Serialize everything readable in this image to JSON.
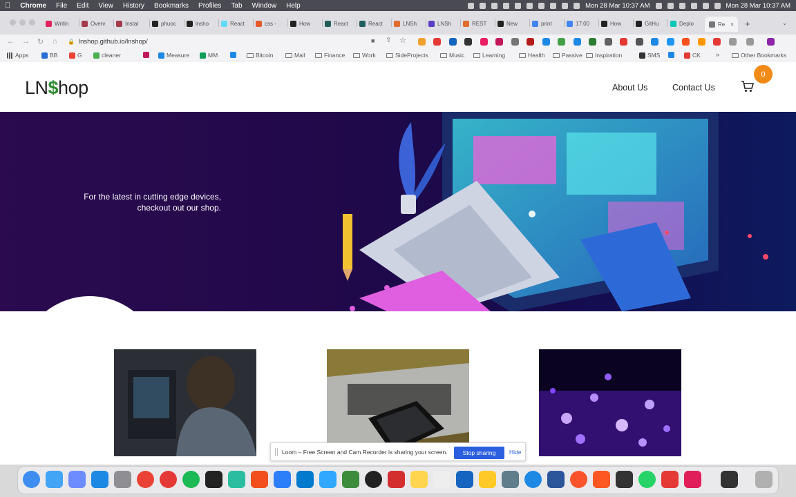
{
  "menubar": {
    "app": "Chrome",
    "items": [
      "File",
      "Edit",
      "View",
      "History",
      "Bookmarks",
      "Profiles",
      "Tab",
      "Window",
      "Help"
    ],
    "datetime": "Mon 28 Mar  10:37 AM"
  },
  "tabs": [
    {
      "label": "Writin",
      "color": "#e0245e"
    },
    {
      "label": "Overv",
      "color": "#a33b4b"
    },
    {
      "label": "Instal",
      "color": "#a33b4b"
    },
    {
      "label": "phuoc",
      "color": "#222222"
    },
    {
      "label": "lnsho",
      "color": "#222222"
    },
    {
      "label": "React",
      "color": "#61dafb"
    },
    {
      "label": "css -",
      "color": "#e55a2b"
    },
    {
      "label": "How",
      "color": "#222222"
    },
    {
      "label": "React",
      "color": "#1f5f5f"
    },
    {
      "label": "React",
      "color": "#1f5f5f"
    },
    {
      "label": "LNSh",
      "color": "#e06c2d"
    },
    {
      "label": "LNSh",
      "color": "#5b3cc4"
    },
    {
      "label": "REST",
      "color": "#e06c2d"
    },
    {
      "label": "New",
      "color": "#222222"
    },
    {
      "label": "print",
      "color": "#4285f4"
    },
    {
      "label": "17:00",
      "color": "#4285f4"
    },
    {
      "label": "How",
      "color": "#222222"
    },
    {
      "label": "GitHu",
      "color": "#222222"
    },
    {
      "label": "Deplo",
      "color": "#00c7b7"
    },
    {
      "label": "Re",
      "color": "#777777",
      "active": true
    }
  ],
  "toolbar": {
    "url": "lnshop.github.io/lnshop/"
  },
  "bookmarks": {
    "items": [
      {
        "label": "Apps",
        "kind": "apps"
      },
      {
        "label": "BB",
        "kind": "icon",
        "color": "#2b6cd4"
      },
      {
        "label": "G",
        "kind": "icon",
        "color": "#ea4335"
      },
      {
        "label": "cleaner",
        "kind": "icon",
        "color": "#4caf50"
      },
      {
        "label": "",
        "kind": "icon",
        "color": "#c2185b"
      },
      {
        "label": "Measure",
        "kind": "icon",
        "color": "#1e88e5"
      },
      {
        "label": "MM",
        "kind": "icon",
        "color": "#0f9d58"
      },
      {
        "label": "",
        "kind": "icon",
        "color": "#1e88e5"
      },
      {
        "label": "Bitcoin",
        "kind": "folder"
      },
      {
        "label": "Mail",
        "kind": "folder"
      },
      {
        "label": "Finance",
        "kind": "folder"
      },
      {
        "label": "Work",
        "kind": "folder"
      },
      {
        "label": "SideProjects",
        "kind": "folder"
      },
      {
        "label": "Music",
        "kind": "folder"
      },
      {
        "label": "Learning",
        "kind": "folder"
      },
      {
        "label": "Health",
        "kind": "folder"
      },
      {
        "label": "Passive",
        "kind": "folder"
      },
      {
        "label": "Inspiration",
        "kind": "folder"
      },
      {
        "label": "SMS",
        "kind": "icon",
        "color": "#333333"
      },
      {
        "label": "",
        "kind": "icon",
        "color": "#1e88e5"
      },
      {
        "label": "CK",
        "kind": "icon",
        "color": "#e53935"
      }
    ],
    "more": "»",
    "other": "Other Bookmarks"
  },
  "site": {
    "logo_left": "LN",
    "logo_mark": "$",
    "logo_right": "hop",
    "nav": [
      "About Us",
      "Contact Us"
    ],
    "cart_count": "0",
    "hero_text": "For the latest in cutting edge devices, checkout out our shop."
  },
  "loom": {
    "text": "Loom – Free Screen and Cam Recorder is sharing your screen.",
    "stop": "Stop sharing",
    "hide": "Hide"
  },
  "colors": {
    "accent_orange": "#f28a17",
    "loom_blue": "#2b5fe0",
    "hero_purple": "#2b0a4f"
  }
}
